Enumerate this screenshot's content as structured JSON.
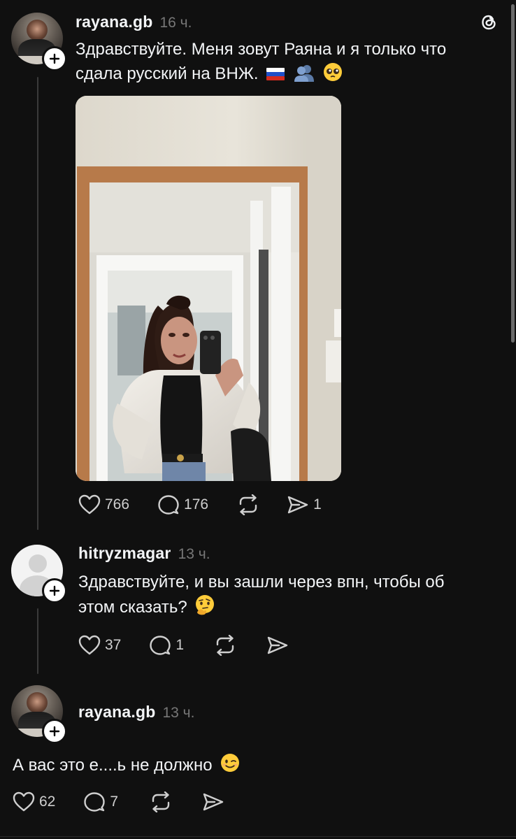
{
  "post": {
    "username": "rayana.gb",
    "time": "16 ч.",
    "text": "Здравствуйте. Меня зовут Раяна  и я только что сдала русский на ВНЖ.",
    "text_line1": "Здравствуйте. Меня зовут Раяна  и я только что",
    "text_line2": "сдала русский на ВНЖ.",
    "emojis": [
      "russian-flag",
      "busts-in-silhouette",
      "pleading-face"
    ],
    "likes": "766",
    "replies": "176",
    "shares": "1"
  },
  "reply1": {
    "username": "hitryzmagar",
    "time": "13 ч.",
    "text_line1": "Здравствуйте, и вы зашли через впн, чтобы об",
    "text_line2": "этом сказать?",
    "emoji": "thinking-face",
    "likes": "37",
    "replies": "1"
  },
  "reply2": {
    "username": "rayana.gb",
    "time": "13 ч.",
    "text": "А вас это е....ь не должно",
    "emoji": "winking-face",
    "likes": "62",
    "replies": "7"
  },
  "colors": {
    "background": "#101010",
    "text": "#f3f5f7",
    "muted": "#777777",
    "thread_line": "#3a3a3a"
  },
  "icons": [
    "threads-logo-icon",
    "heart-icon",
    "comment-icon",
    "repost-icon",
    "share-icon",
    "plus-icon"
  ]
}
